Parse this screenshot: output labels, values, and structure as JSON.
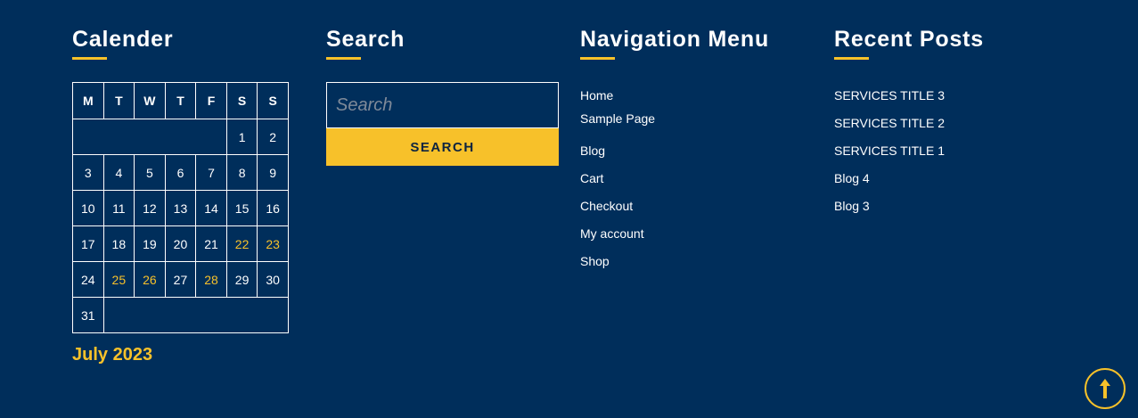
{
  "calendar": {
    "title": "Calender",
    "weekdays": [
      "M",
      "T",
      "W",
      "T",
      "F",
      "S",
      "S"
    ],
    "caption": "July 2023",
    "days": [
      "1",
      "2",
      "3",
      "4",
      "5",
      "6",
      "7",
      "8",
      "9",
      "10",
      "11",
      "12",
      "13",
      "14",
      "15",
      "16",
      "17",
      "18",
      "19",
      "20",
      "21",
      "22",
      "23",
      "24",
      "25",
      "26",
      "27",
      "28",
      "29",
      "30",
      "31"
    ],
    "linked_days": [
      "22",
      "23",
      "25",
      "26",
      "28"
    ]
  },
  "search": {
    "title": "Search",
    "placeholder": "Search",
    "button_label": "SEARCH"
  },
  "navigation": {
    "title": "Navigation Menu",
    "items": [
      "Home",
      "Sample Page",
      "Blog",
      "Cart",
      "Checkout",
      "My account",
      "Shop"
    ]
  },
  "recent_posts": {
    "title": "Recent Posts",
    "items": [
      "SERVICES TITLE 3",
      "SERVICES TITLE 2",
      "SERVICES TITLE 1",
      "Blog 4",
      "Blog 3"
    ]
  },
  "back_to_top": {
    "icon": "arrow-up-icon"
  },
  "colors": {
    "background": "#002e5b",
    "accent": "#f7c12a",
    "text": "#ffffff"
  }
}
